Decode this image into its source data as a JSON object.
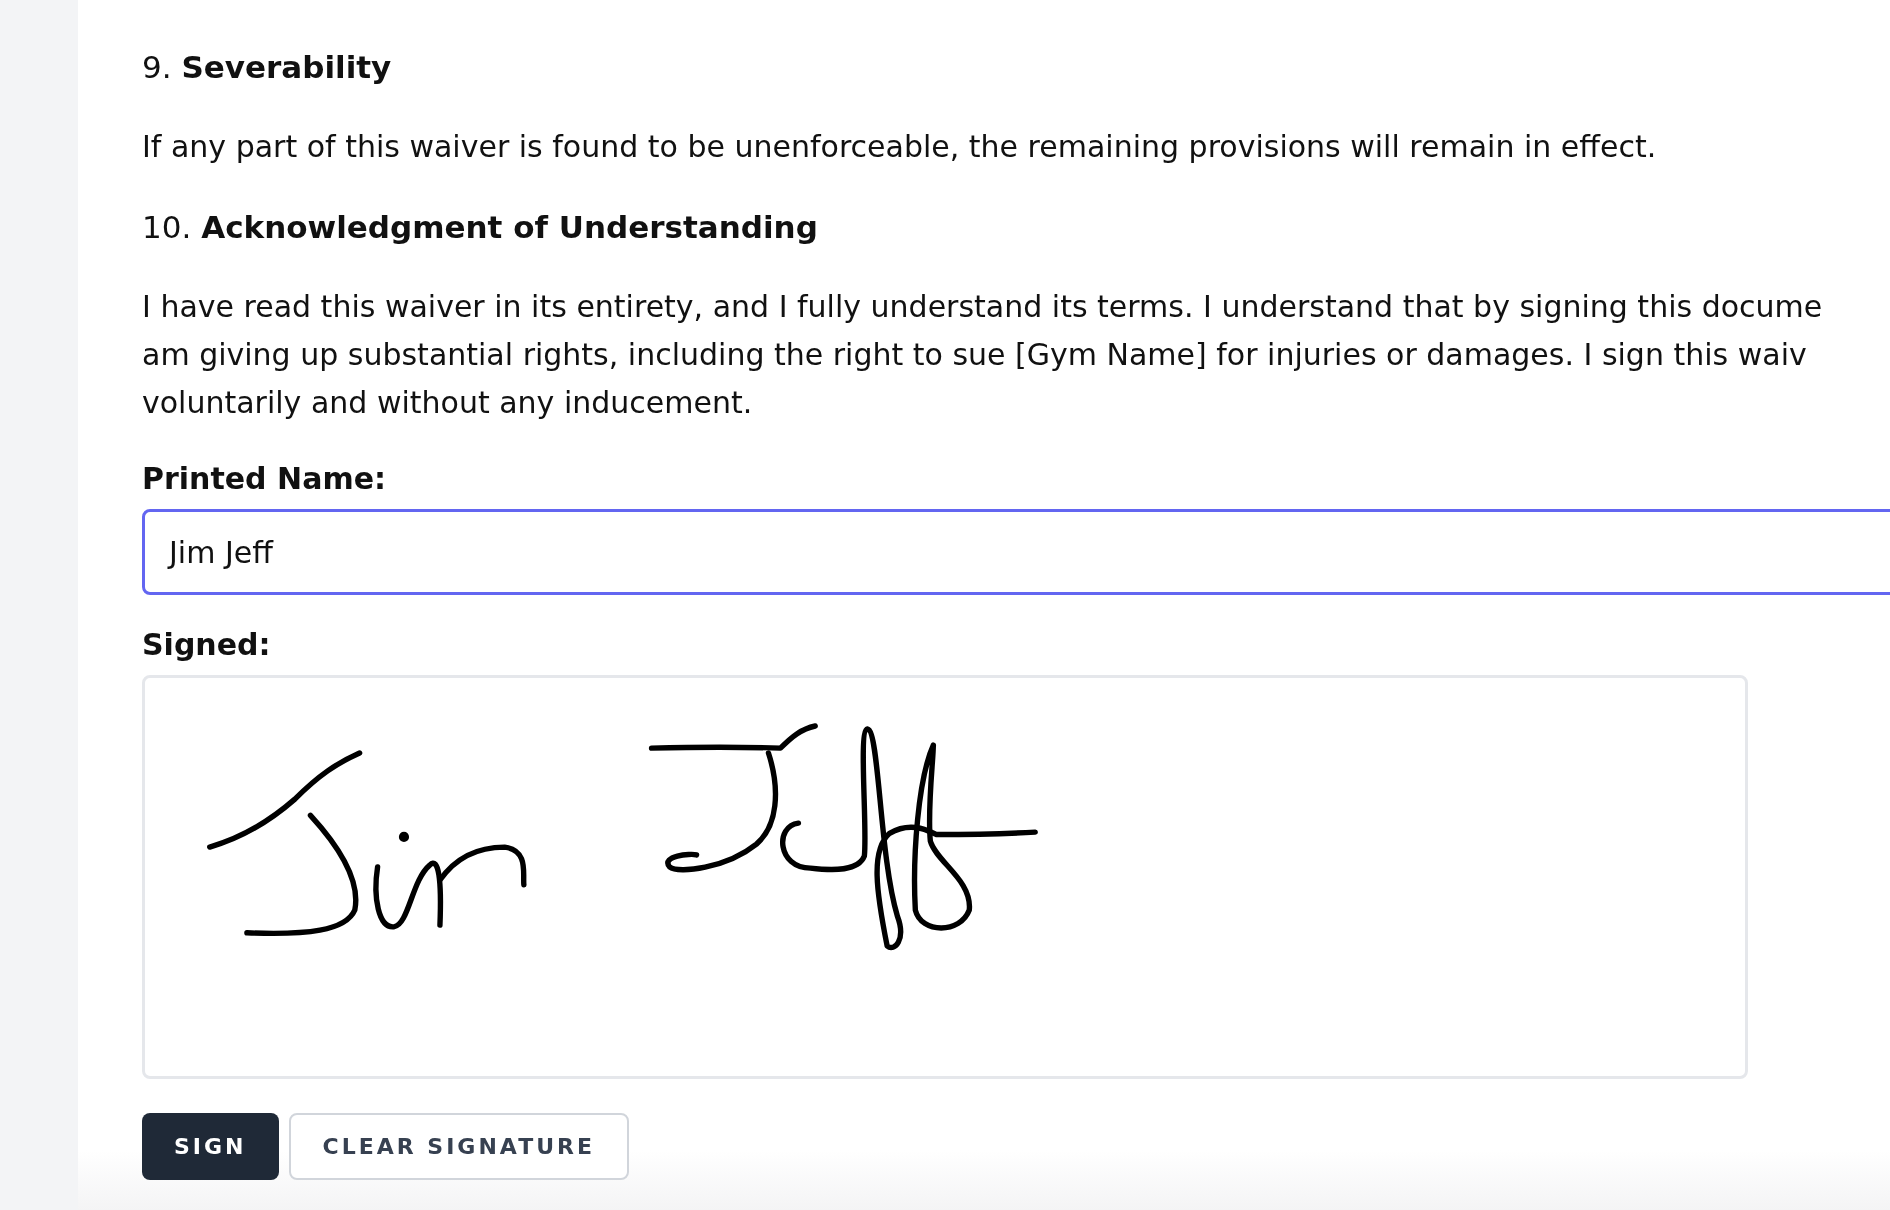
{
  "sections": [
    {
      "number": "9.",
      "title": "Severability",
      "lines": [
        "If any part of this waiver is found to be unenforceable, the remaining provisions will remain in effect."
      ]
    },
    {
      "number": "10.",
      "title": "Acknowledgment of Understanding",
      "lines": [
        "I have read this waiver in its entirety, and I fully understand its terms. I understand that by signing this docume",
        "am giving up substantial rights, including the right to sue [Gym Name] for injuries or damages. I sign this waiv",
        "voluntarily and without any inducement."
      ]
    }
  ],
  "printed_name": {
    "label": "Printed Name:",
    "value": "Jim Jeff",
    "focused": true
  },
  "signature": {
    "label": "Signed:",
    "signed": true
  },
  "buttons": [
    {
      "label": "SIGN",
      "kind": "primary"
    },
    {
      "label": "CLEAR SIGNATURE",
      "kind": "secondary"
    }
  ]
}
